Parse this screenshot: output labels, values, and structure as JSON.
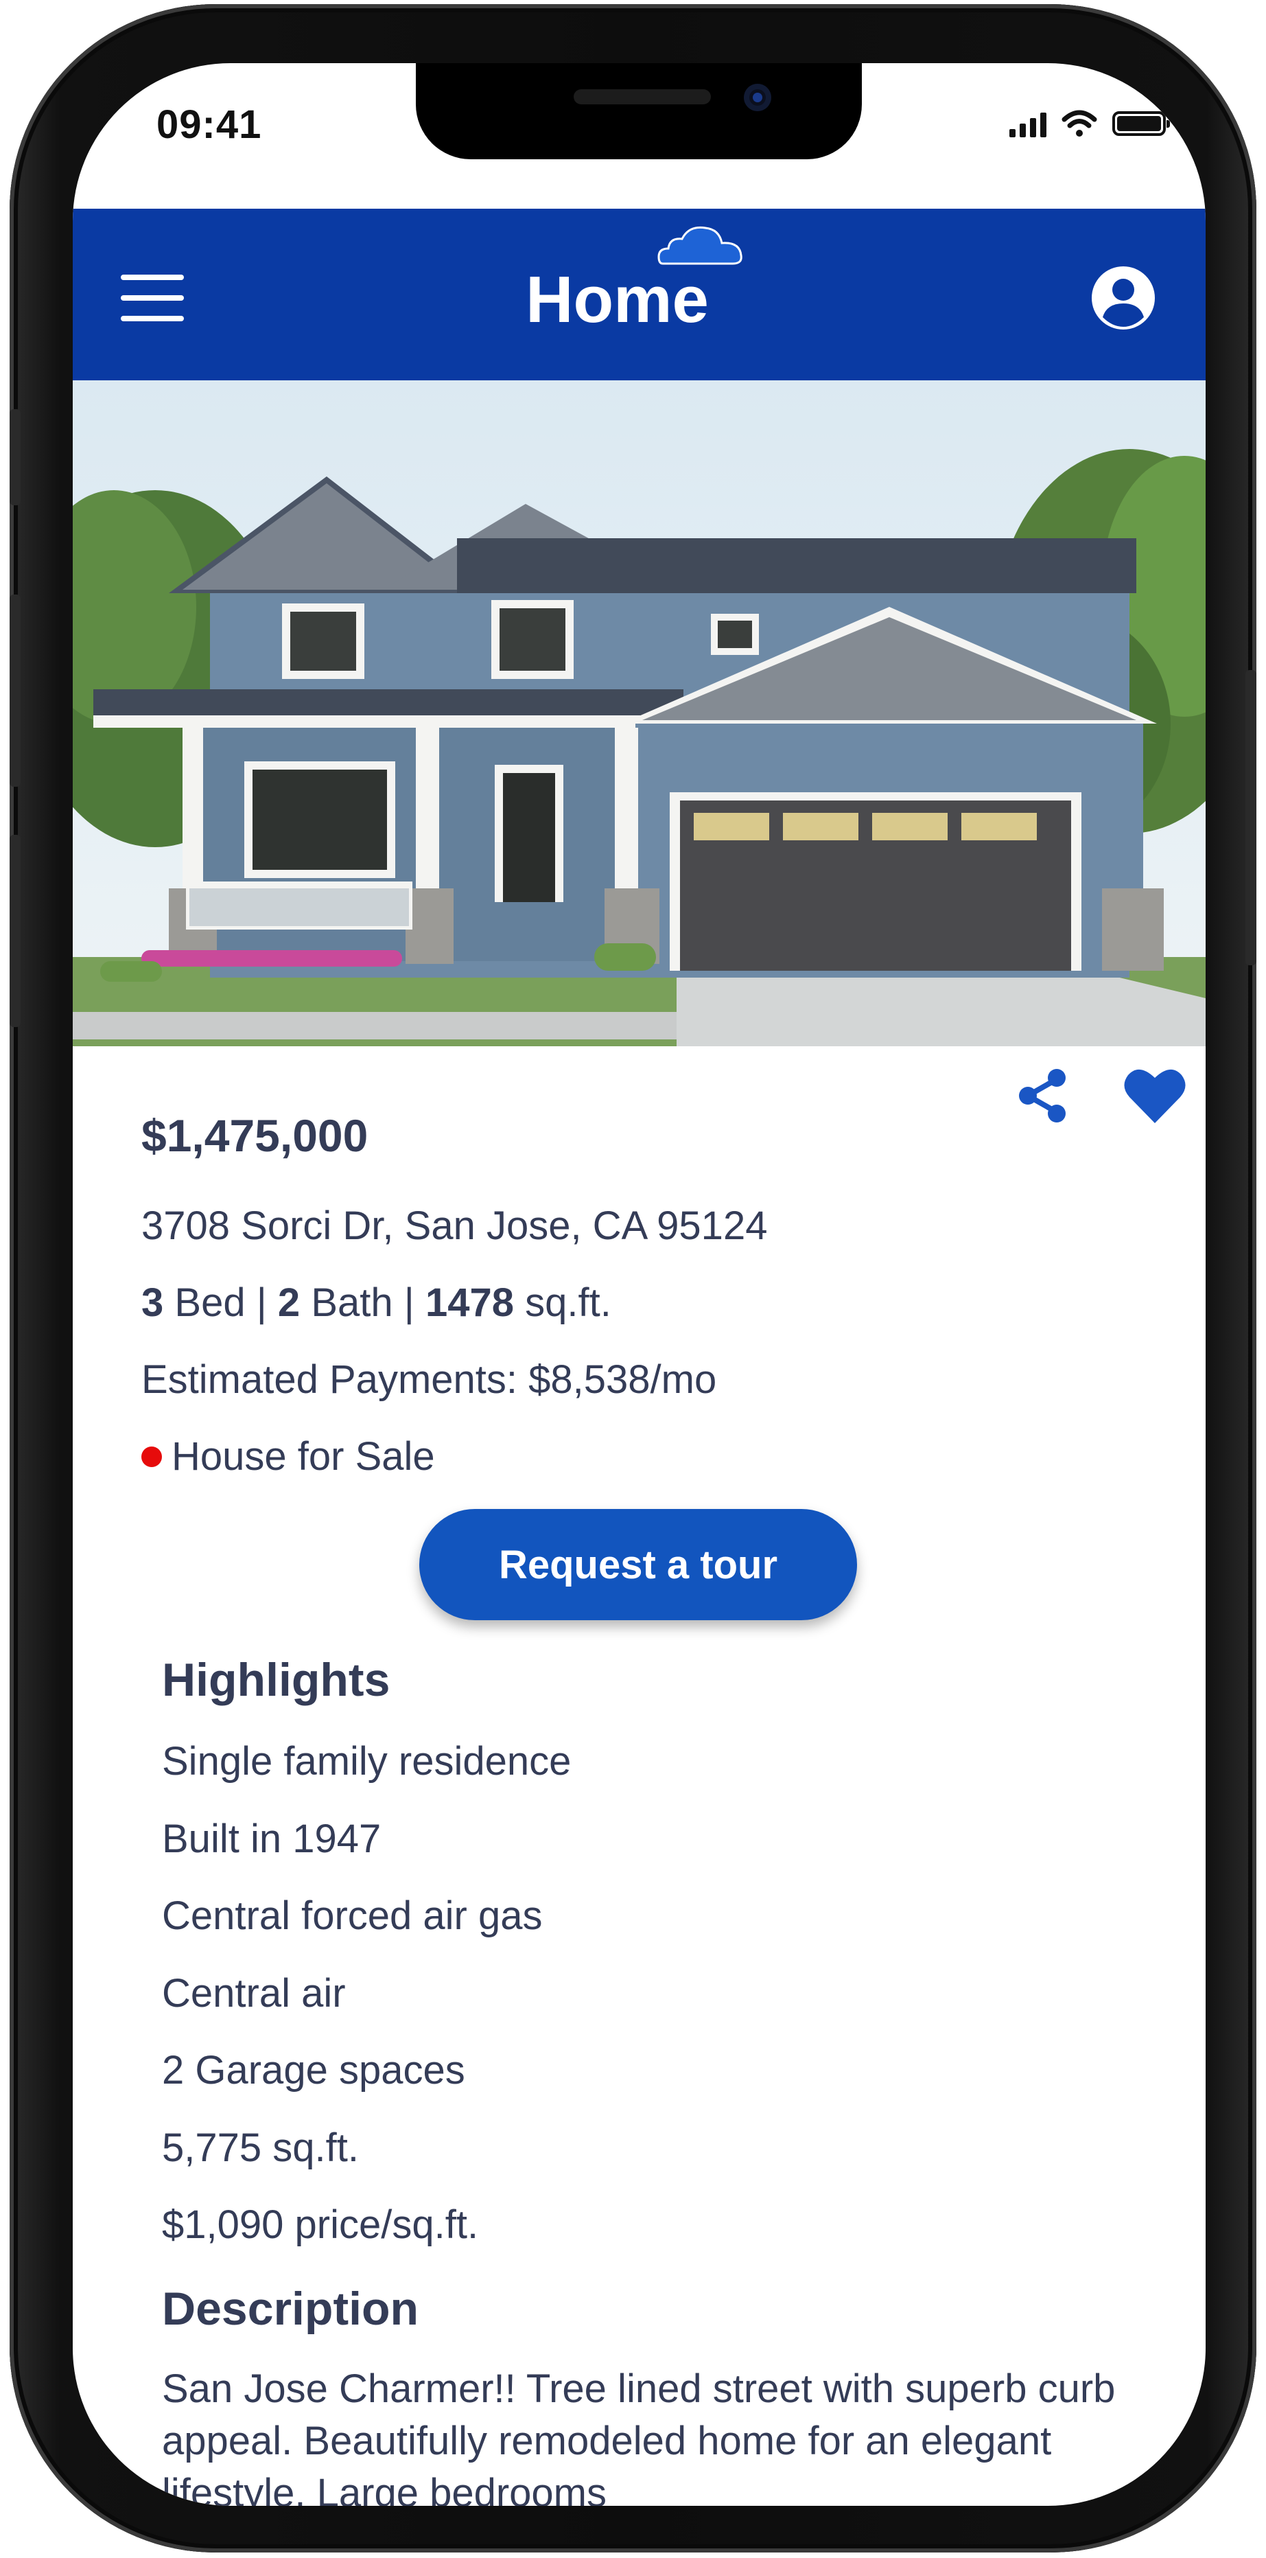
{
  "status_bar": {
    "time": "09:41"
  },
  "header": {
    "title": "Home"
  },
  "listing": {
    "price": "$1,475,000",
    "address": "3708 Sorci Dr, San Jose, CA 95124",
    "beds": "3",
    "beds_label": "Bed",
    "baths": "2",
    "baths_label": "Bath",
    "sqft": "1478",
    "sqft_label": "sq.ft.",
    "separator": "|",
    "estimated_payments": "Estimated Payments: $8,538/mo",
    "status": "House for Sale",
    "status_color": "#e60b0b"
  },
  "actions": {
    "share_icon": "share-icon",
    "favorite_icon": "heart-icon",
    "request_tour_label": "Request a tour"
  },
  "highlights": {
    "title": "Highlights",
    "items": [
      "Single family residence",
      "Built in 1947",
      "Central forced air gas",
      "Central air",
      "2 Garage spaces",
      "5,775 sq.ft.",
      "$1,090 price/sq.ft."
    ]
  },
  "description": {
    "title": "Description",
    "text": "San Jose Charmer!! Tree lined street with superb curb appeal. Beautifully remodeled home for an elegant lifestyle. Large bedrooms"
  },
  "colors": {
    "header_blue": "#0a3aa3",
    "button_blue": "#1255be",
    "text_dark": "#343c57",
    "icon_blue": "#1a56c4"
  }
}
